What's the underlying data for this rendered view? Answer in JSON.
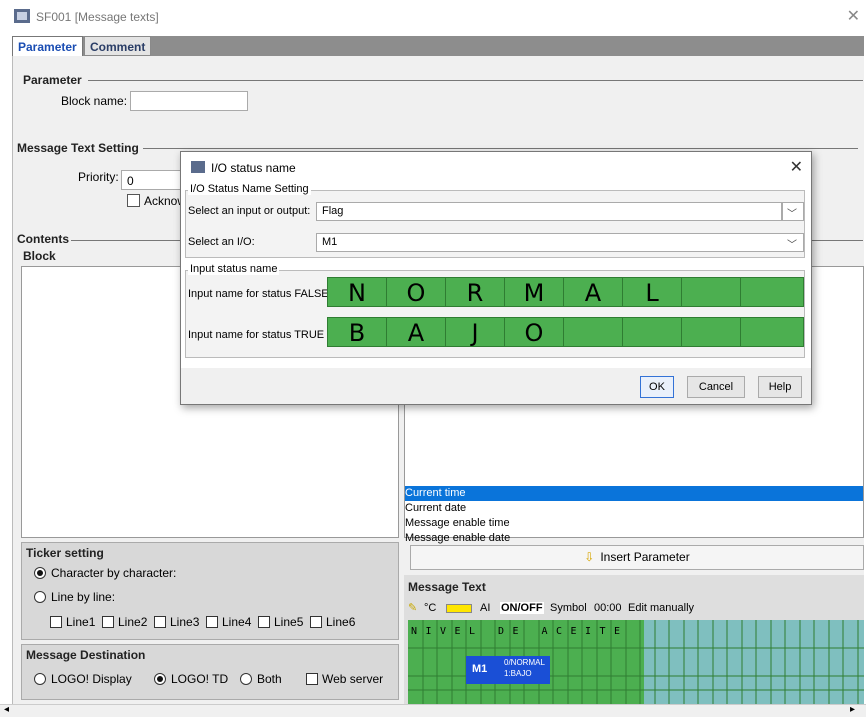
{
  "window": {
    "title": "SF001 [Message texts]"
  },
  "tabs": [
    {
      "label": "Parameter"
    },
    {
      "label": "Comment"
    }
  ],
  "parameter": {
    "section_title": "Parameter",
    "block_name_label": "Block name:",
    "block_name_value": ""
  },
  "message_text_setting": {
    "title": "Message Text Setting",
    "priority_label": "Priority:",
    "priority_value": "0",
    "acknowledge_label": "Acknowl"
  },
  "contents": {
    "title": "Contents",
    "block_title": "Block"
  },
  "param_list": [
    "Current time",
    "Current date",
    "Message enable time",
    "Message enable date"
  ],
  "insert_parameter_label": "Insert Parameter",
  "ticker": {
    "title": "Ticker setting",
    "options": [
      "Character by character:",
      "Line by line:"
    ],
    "lines": [
      "Line1",
      "Line2",
      "Line3",
      "Line4",
      "Line5",
      "Line6"
    ]
  },
  "destination": {
    "title": "Message Destination",
    "options": [
      "LOGO! Display",
      "LOGO! TD",
      "Both"
    ],
    "web_server_label": "Web server"
  },
  "message_text": {
    "title": "Message Text",
    "toolbar": {
      "degree": "°C",
      "ai": "AI",
      "onoff": "ON/OFF",
      "symbol": "Symbol",
      "time": "00:00",
      "edit": "Edit manually"
    },
    "row1_chars": [
      "N",
      "I",
      "V",
      "E",
      "L",
      "",
      "D",
      "E",
      "",
      "A",
      "C",
      "E",
      "I",
      "T",
      "E",
      ""
    ],
    "io_block": {
      "name": "M1",
      "false_text": "0/NORMAL",
      "true_text": "1:BAJO"
    }
  },
  "dialog": {
    "title": "I/O status name",
    "group1_legend": "I/O Status Name Setting",
    "select_io_label": "Select an input or output:",
    "select_io_value": "Flag",
    "select_label": "Select an I/O:",
    "select_value": "M1",
    "group2_legend": "Input status name",
    "false_label": "Input name for status FALSE",
    "true_label": "Input name for status TRUE",
    "false_chars": [
      "N",
      "O",
      "R",
      "M",
      "A",
      "L",
      "",
      ""
    ],
    "true_chars": [
      "B",
      "A",
      "J",
      "O",
      "",
      "",
      "",
      ""
    ],
    "buttons": {
      "ok": "OK",
      "cancel": "Cancel",
      "help": "Help"
    }
  },
  "colors": {
    "accent": "#0a74da",
    "grid_green": "#4caf50",
    "grid_teal": "#7fbfbf"
  }
}
